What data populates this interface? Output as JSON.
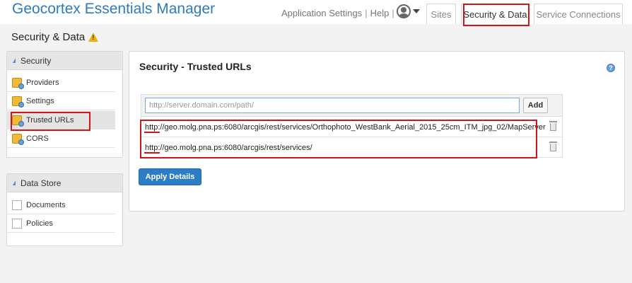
{
  "app": {
    "title": "Geocortex Essentials Manager"
  },
  "top_nav": {
    "links": [
      "Application Settings",
      "Help"
    ],
    "tabs": [
      "Sites",
      "Security & Data",
      "Service Connections"
    ]
  },
  "page": {
    "title": "Security & Data"
  },
  "sidebar": {
    "security": {
      "header": "Security",
      "items": [
        "Providers",
        "Settings",
        "Trusted URLs",
        "CORS"
      ],
      "active": "Trusted URLs"
    },
    "data_store": {
      "header": "Data Store",
      "items": [
        "Documents",
        "Policies"
      ]
    }
  },
  "main": {
    "title": "Security - Trusted URLs",
    "input": {
      "placeholder": "http://server.domain.com/path/",
      "value": ""
    },
    "add_label": "Add",
    "urls": [
      "http://geo.molg.pna.ps:6080/arcgis/rest/services/Orthophoto_WestBank_Aerial_2015_25cm_ITM_jpg_02/MapServer",
      "http://geo.molg.pna.ps:6080/arcgis/rest/services/"
    ],
    "apply_label": "Apply Details"
  },
  "colors": {
    "brand_blue": "#2d7bbd",
    "apply_button": "#2c7cc6",
    "highlight_red": "#d0161b",
    "warning": "#e8b20c"
  },
  "icons": [
    "user-icon",
    "chevron-down-icon",
    "warning-icon",
    "help-icon",
    "lock-icon",
    "document-icon",
    "trash-icon"
  ]
}
